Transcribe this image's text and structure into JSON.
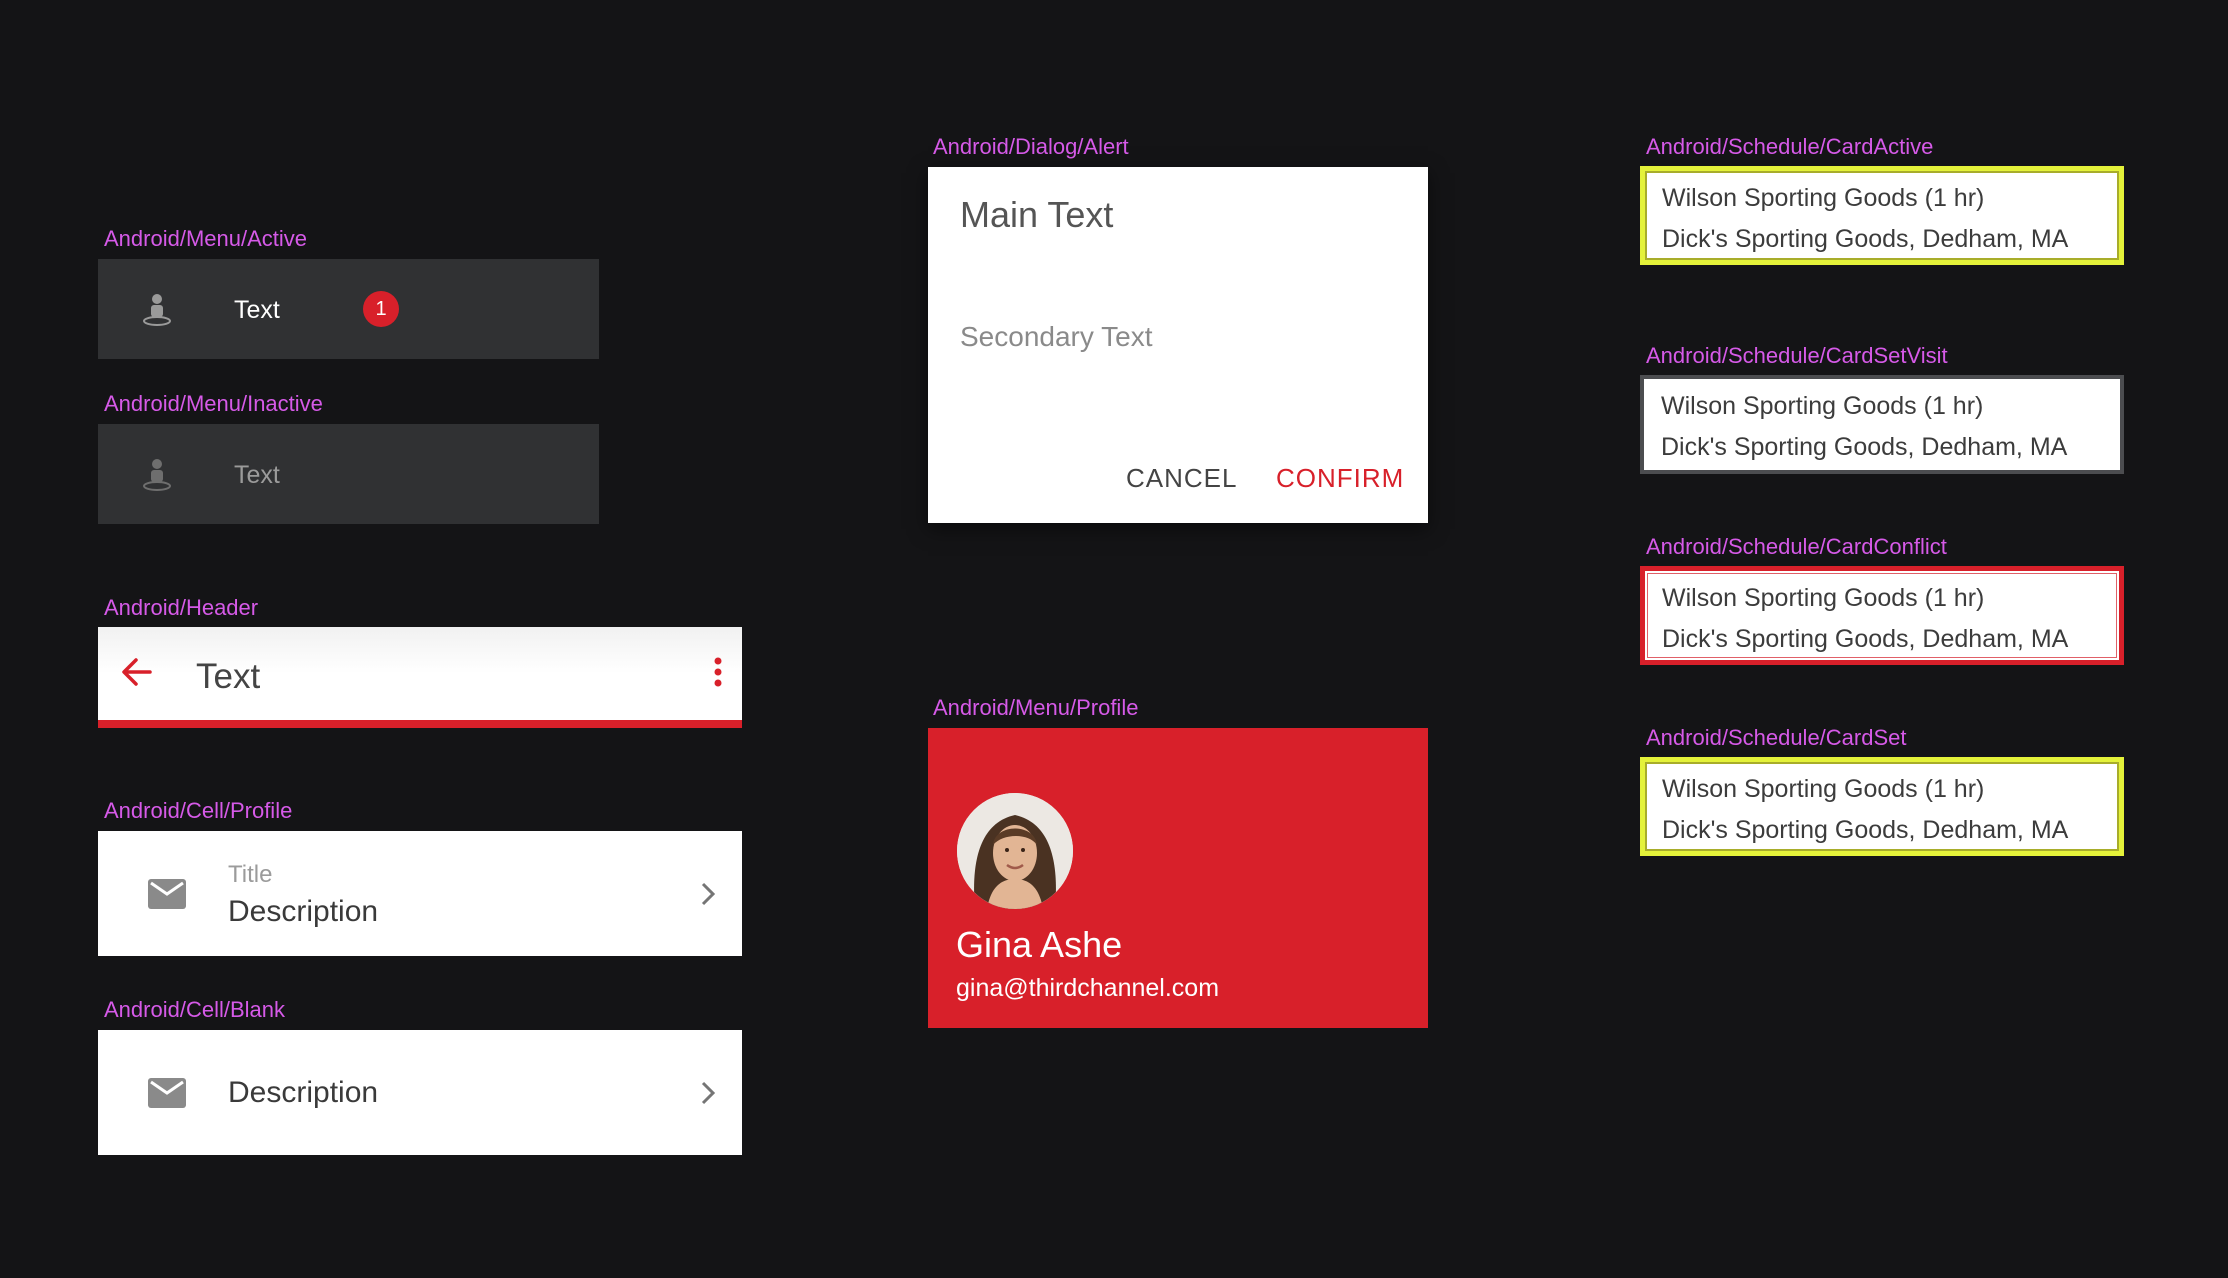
{
  "frames": {
    "menu_active": "Android/Menu/Active",
    "menu_inactive": "Android/Menu/Inactive",
    "header": "Android/Header",
    "cell_profile": "Android/Cell/Profile",
    "cell_blank": "Android/Cell/Blank",
    "dialog_alert": "Android/Dialog/Alert",
    "menu_profile": "Android/Menu/Profile",
    "card_active": "Android/Schedule/CardActive",
    "card_set_visit": "Android/Schedule/CardSetVisit",
    "card_conflict": "Android/Schedule/CardConflict",
    "card_set": "Android/Schedule/CardSet"
  },
  "menu_active": {
    "label": "Text",
    "badge": "1",
    "icon": "person-pin-icon"
  },
  "menu_inactive": {
    "label": "Text",
    "icon": "person-pin-icon"
  },
  "header": {
    "title": "Text",
    "back_icon": "arrow-back-icon",
    "more_icon": "more-vertical-icon"
  },
  "cell_profile": {
    "title": "Title",
    "description": "Description",
    "icon": "mail-icon"
  },
  "cell_blank": {
    "description": "Description",
    "icon": "mail-icon"
  },
  "dialog": {
    "main_text": "Main Text",
    "secondary_text": "Secondary Text",
    "cancel": "CANCEL",
    "confirm": "CONFIRM"
  },
  "profile": {
    "name": "Gina Ashe",
    "email": "gina@thirdchannel.com"
  },
  "cards": {
    "active": {
      "line1": "Wilson Sporting Goods (1 hr)",
      "line2": "Dick's Sporting Goods, Dedham, MA"
    },
    "set_visit": {
      "line1": "Wilson Sporting Goods (1 hr)",
      "line2": "Dick's Sporting Goods, Dedham, MA"
    },
    "conflict": {
      "line1": "Wilson Sporting Goods (1 hr)",
      "line2": "Dick's Sporting Goods, Dedham, MA"
    },
    "set": {
      "line1": "Wilson Sporting Goods (1 hr)",
      "line2": "Dick's Sporting Goods, Dedham, MA"
    }
  },
  "colors": {
    "background": "#141416",
    "label": "#d65ae8",
    "accent_red": "#d8202a",
    "card_yellow": "#e4f23a",
    "menu_bg": "#303133"
  }
}
